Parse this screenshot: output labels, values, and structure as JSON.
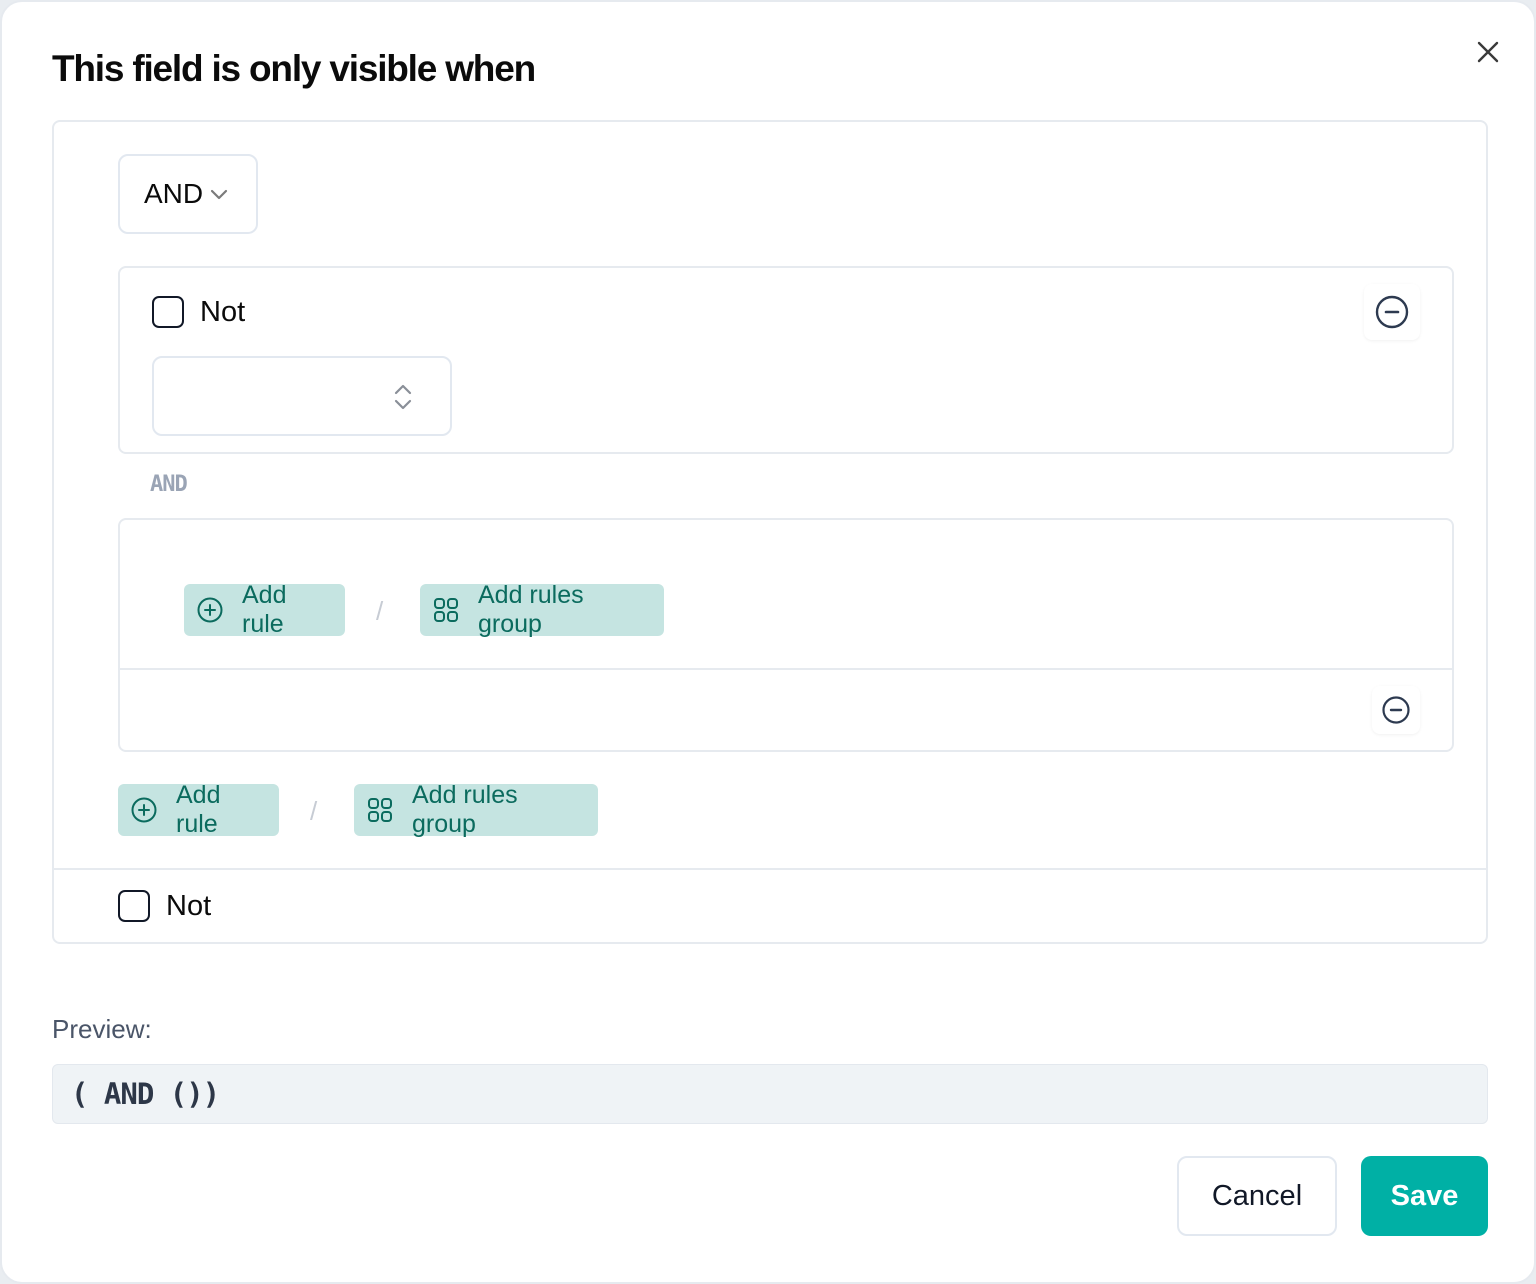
{
  "dialog": {
    "title": "This field is only visible when",
    "close_icon": "close-icon"
  },
  "query_builder": {
    "combinator": {
      "value": "AND",
      "icon": "chevron-down-icon"
    },
    "rule": {
      "not_label": "Not",
      "not_checked": false,
      "field_value": "",
      "field_icon": "chevron-up-down-icon",
      "remove_icon": "minus-circle-icon"
    },
    "separator_label": "AND",
    "subgroup": {
      "add_rule_label": "Add rule",
      "add_rule_icon": "plus-circle-icon",
      "slash": "/",
      "add_group_label": "Add rules group",
      "add_group_icon": "grid-icon",
      "remove_icon": "minus-circle-icon"
    },
    "root_actions": {
      "add_rule_label": "Add rule",
      "slash": "/",
      "add_group_label": "Add rules group"
    },
    "root_not_label": "Not",
    "root_not_checked": false
  },
  "preview": {
    "label": "Preview:",
    "value": "( AND ())"
  },
  "footer": {
    "cancel_label": "Cancel",
    "save_label": "Save",
    "save_color": "#00b0a5",
    "button_bg": "#c5e4e1",
    "button_text_color": "#0b6b5e"
  }
}
